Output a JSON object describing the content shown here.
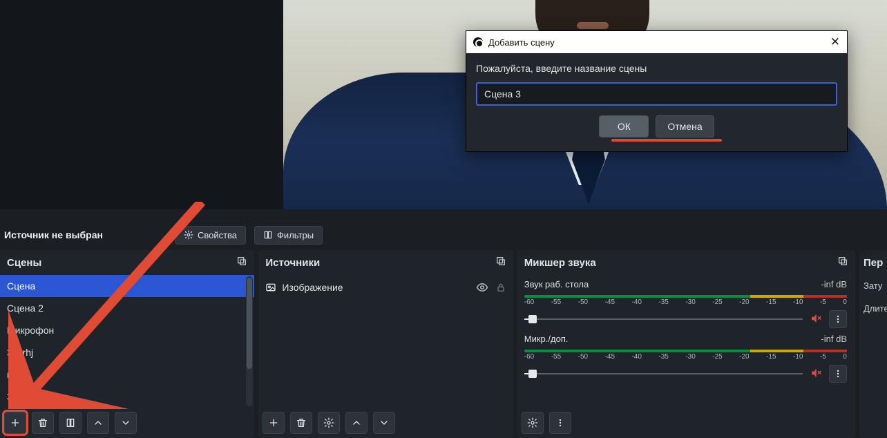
{
  "toolbar": {
    "no_source_label": "Источник не выбран",
    "properties": "Свойства",
    "filters": "Фильтры"
  },
  "scenes": {
    "title": "Сцены",
    "items": [
      "Сцена",
      "Сцена 2",
      "Микрофон",
      "3vbrhj",
      "micr",
      "Запись"
    ],
    "selected_index": 0
  },
  "sources": {
    "title": "Источники",
    "items": [
      {
        "label": "Изображение",
        "visible": true,
        "locked": true
      }
    ]
  },
  "mixer": {
    "title": "Микшер звука",
    "ticks": [
      "-60",
      "-55",
      "-50",
      "-45",
      "-40",
      "-35",
      "-30",
      "-25",
      "-20",
      "-15",
      "-10",
      "-5",
      "0"
    ],
    "channels": [
      {
        "name": "Звук раб. стола",
        "db": "-inf dB"
      },
      {
        "name": "Микр./доп.",
        "db": "-inf dB"
      }
    ]
  },
  "transitions": {
    "title_fragment": "Пер",
    "row1": "Зату",
    "row2": "Длите"
  },
  "dialog": {
    "title": "Добавить сцену",
    "prompt": "Пожалуйста, введите название сцены",
    "value": "Сцена 3",
    "ok": "ОК",
    "cancel": "Отмена"
  }
}
